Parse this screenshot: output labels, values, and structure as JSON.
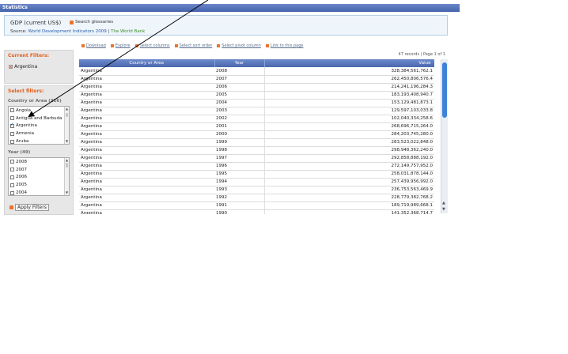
{
  "window": {
    "title": "Statistics"
  },
  "header": {
    "title": "GDP (current US$)",
    "glossary_label": "Search glossaries",
    "source_label": "Source:",
    "source_link": "World Development Indicators 2009",
    "separator": "|",
    "source_org": "The World Bank"
  },
  "toolbar": {
    "items": [
      "Download",
      "Explore",
      "Select columns",
      "Select sort order",
      "Select pivot column",
      "Link to this page"
    ]
  },
  "records": {
    "text": "47 records | Page 1 of 1"
  },
  "current_filters": {
    "heading": "Current Filters:",
    "items": [
      "Argentina"
    ]
  },
  "select_filters": {
    "heading": "Select filters:",
    "country_heading": "Country or Area (216)",
    "countries": [
      {
        "label": "Angola",
        "checked": false
      },
      {
        "label": "Antigua and Barbuda",
        "checked": false
      },
      {
        "label": "Argentina",
        "checked": true
      },
      {
        "label": "Armenia",
        "checked": false
      },
      {
        "label": "Aruba",
        "checked": false
      }
    ],
    "year_heading": "Year (49)",
    "years": [
      {
        "label": "2008",
        "checked": false
      },
      {
        "label": "2007",
        "checked": false
      },
      {
        "label": "2006",
        "checked": false
      },
      {
        "label": "2005",
        "checked": false
      },
      {
        "label": "2004",
        "checked": false
      }
    ],
    "apply_label": "Apply Filters"
  },
  "table": {
    "columns": [
      "Country or Area",
      "Year",
      "Value"
    ],
    "rows": [
      [
        "Argentina",
        "2008",
        "328,384,561,762.1"
      ],
      [
        "Argentina",
        "2007",
        "262,450,806,576.4"
      ],
      [
        "Argentina",
        "2006",
        "214,241,196,284.3"
      ],
      [
        "Argentina",
        "2005",
        "183,193,408,940.7"
      ],
      [
        "Argentina",
        "2004",
        "153,129,481,873.1"
      ],
      [
        "Argentina",
        "2003",
        "129,597,103,033.8"
      ],
      [
        "Argentina",
        "2002",
        "102,040,334,258.6"
      ],
      [
        "Argentina",
        "2001",
        "268,696,715,264.0"
      ],
      [
        "Argentina",
        "2000",
        "284,203,745,280.0"
      ],
      [
        "Argentina",
        "1999",
        "283,523,022,848.0"
      ],
      [
        "Argentina",
        "1998",
        "298,948,362,240.0"
      ],
      [
        "Argentina",
        "1997",
        "292,858,888,192.0"
      ],
      [
        "Argentina",
        "1996",
        "272,149,757,952.0"
      ],
      [
        "Argentina",
        "1995",
        "258,031,878,144.0"
      ],
      [
        "Argentina",
        "1994",
        "257,439,956,992.0"
      ],
      [
        "Argentina",
        "1993",
        "236,753,563,469.9"
      ],
      [
        "Argentina",
        "1992",
        "228,779,382,768.2"
      ],
      [
        "Argentina",
        "1991",
        "189,719,989,668.1"
      ],
      [
        "Argentina",
        "1990",
        "141,352,368,714.7"
      ]
    ]
  },
  "colors": {
    "titlebar": "#4563ac",
    "accent_orange": "#e2611d",
    "table_header": "#5b78bd",
    "scroll_thumb": "#3f83d8"
  }
}
